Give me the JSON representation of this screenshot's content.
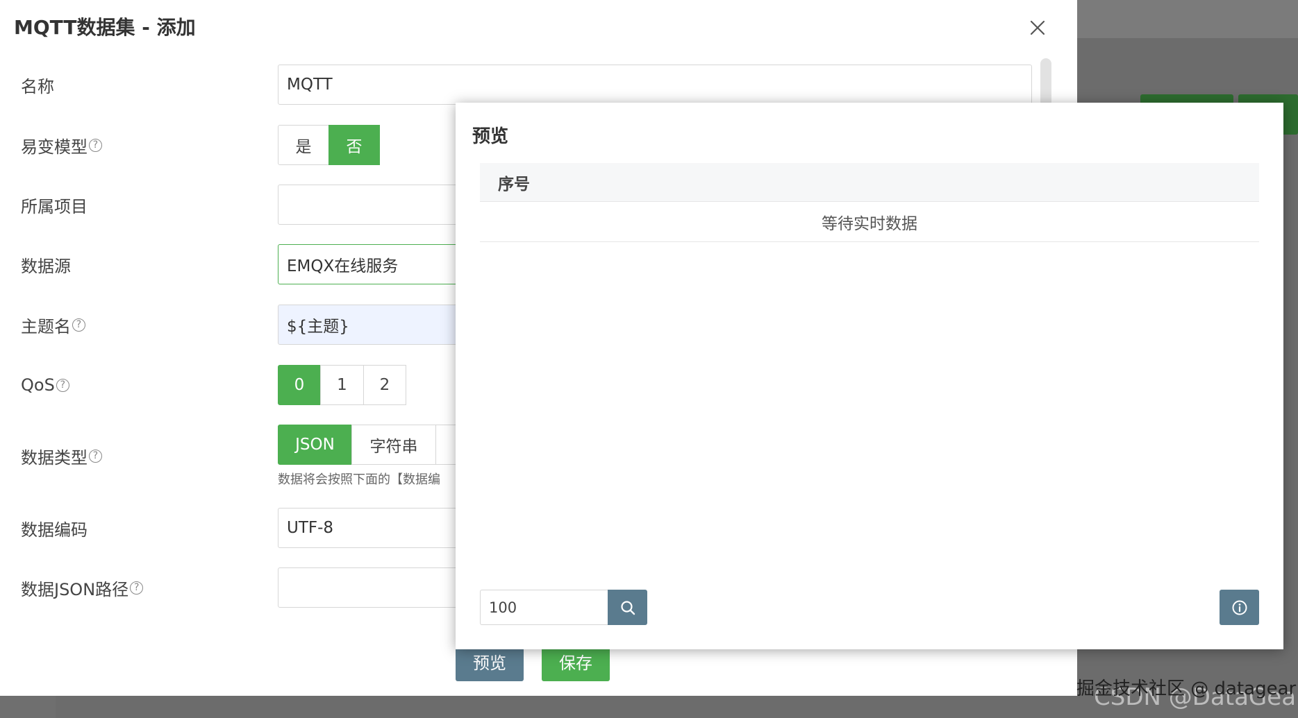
{
  "dialog": {
    "title": "MQTT数据集 - 添加",
    "close_icon": "close-icon"
  },
  "form": {
    "name": {
      "label": "名称",
      "value": "MQTT"
    },
    "volatile_model": {
      "label": "易变模型",
      "options": [
        "是",
        "否"
      ],
      "selected": "否"
    },
    "project": {
      "label": "所属项目",
      "value": ""
    },
    "datasource": {
      "label": "数据源",
      "value": "EMQX在线服务"
    },
    "topic": {
      "label": "主题名",
      "value": "${主题}"
    },
    "qos": {
      "label": "QoS",
      "options": [
        "0",
        "1",
        "2"
      ],
      "selected": "0"
    },
    "data_type": {
      "label": "数据类型",
      "options": [
        "JSON",
        "字符串"
      ],
      "selected": "JSON",
      "hint": "数据将会按照下面的【数据编"
    },
    "encoding": {
      "label": "数据编码",
      "value": "UTF-8"
    },
    "json_path": {
      "label": "数据JSON路径",
      "value": ""
    },
    "help_symbol": "?"
  },
  "footer": {
    "preview_label": "预览",
    "save_label": "保存"
  },
  "preview_popup": {
    "title": "预览",
    "table_header": "序号",
    "empty_text": "等待实时数据",
    "fetch_count": "100",
    "search_icon": "search-icon",
    "info_icon": "info-icon"
  },
  "watermark": {
    "line1": "掘金技术社区 @ datagear",
    "line2": "CSDN @DataGear"
  },
  "colors": {
    "success": "#4caf50",
    "slate": "#5a7b8e",
    "overlay": "#6f6f6f"
  }
}
